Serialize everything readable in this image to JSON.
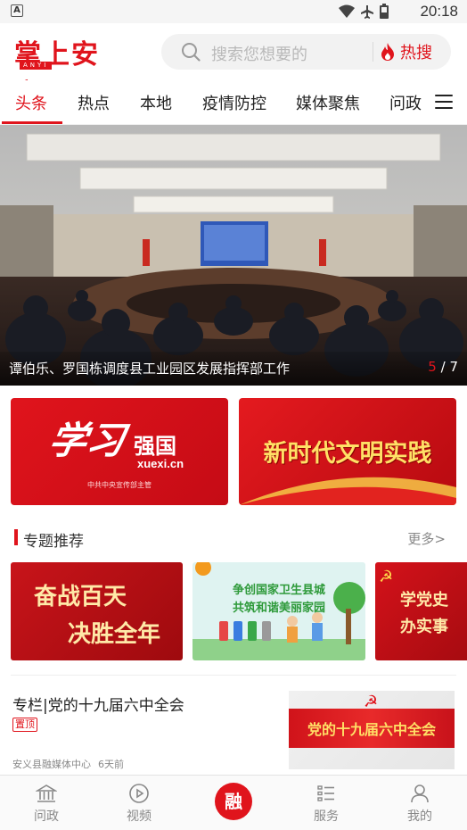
{
  "status_bar": {
    "app_badge": "A",
    "time": "20:18",
    "icons": [
      "wifi-icon",
      "airplane-icon",
      "battery-icon"
    ]
  },
  "header": {
    "logo_text": "掌上安义",
    "logo_sub": "ANYI",
    "search_placeholder": "搜索您想要的",
    "hot_search_label": "热搜"
  },
  "tabs": [
    {
      "label": "头条",
      "active": true
    },
    {
      "label": "热点"
    },
    {
      "label": "本地"
    },
    {
      "label": "疫情防控"
    },
    {
      "label": "媒体聚焦"
    },
    {
      "label": "问政"
    }
  ],
  "banner": {
    "caption": "谭伯乐、罗国栋调度县工业园区发展指挥部工作",
    "pager_current": "5",
    "pager_total": "/ 7"
  },
  "features": {
    "xuexi": {
      "script": "学习",
      "brand": "强国",
      "url": "xuexi.cn",
      "sub": "中共中央宣传部主管"
    },
    "wenming": {
      "title": "新时代文明实践"
    }
  },
  "section": {
    "title": "专题推荐",
    "more": "更多>"
  },
  "topics": [
    {
      "line1": "奋战百天",
      "line2": "决胜全年"
    },
    {
      "line1": "争创国家卫生县城",
      "line2": "共筑和谐美丽家园"
    },
    {
      "line1": "学党史",
      "line2": "办实事"
    }
  ],
  "news": {
    "title": "专栏|党的十九届六中全会",
    "badge": "置顶",
    "source": "安义县融媒体中心",
    "time": "6天前",
    "thumb_text": "党的十九届六中全会"
  },
  "bottom_nav": {
    "items": [
      {
        "label": "问政",
        "icon": "bank-icon"
      },
      {
        "label": "视频",
        "icon": "play-icon"
      },
      {
        "label": "融",
        "icon": "center-icon"
      },
      {
        "label": "服务",
        "icon": "list-icon"
      },
      {
        "label": "我的",
        "icon": "user-icon"
      }
    ]
  },
  "colors": {
    "brand_red": "#e0141c",
    "muted": "#888888"
  }
}
